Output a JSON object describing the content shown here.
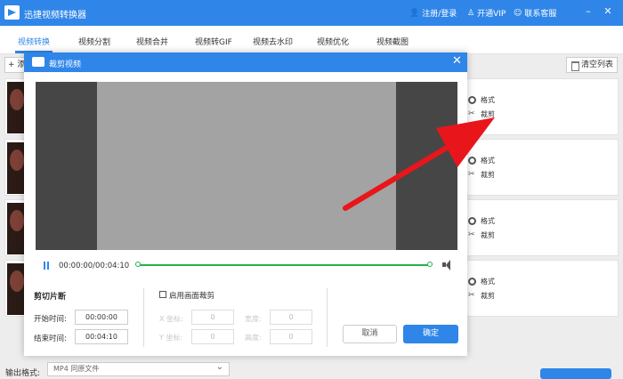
{
  "app": {
    "title": "迅捷视频转换器"
  },
  "header": {
    "login": "注册/登录",
    "vip": "开通VIP",
    "contact": "联系客服"
  },
  "tabs": [
    "视频转换",
    "视频分割",
    "视频合并",
    "视频转GIF",
    "视频去水印",
    "视频优化",
    "视频截图"
  ],
  "toolbar": {
    "add_label": "+ 添",
    "clear_label": "清空列表"
  },
  "file_list": {
    "actions": {
      "format": "格式",
      "crop": "裁剪"
    }
  },
  "dialog": {
    "title": "裁剪视频",
    "timecode": "00:00:00/00:04:10",
    "progress": 0,
    "cut_section": {
      "title": "剪切片断",
      "start_label": "开始时间:",
      "start_value": "00:00:00",
      "end_label": "结束时间:",
      "end_value": "00:04:10"
    },
    "crop": {
      "enable_label": "启用画面裁剪",
      "enabled": false,
      "x_label": "X 坐标:",
      "y_label": "Y 坐标:",
      "width_label": "宽度:",
      "height_label": "高度:",
      "x_value": "0",
      "y_value": "0",
      "width_value": "0",
      "height_value": "0"
    },
    "cancel_label": "取消",
    "ok_label": "确定"
  },
  "output": {
    "label": "输出格式:",
    "value": "MP4  同原文件"
  },
  "colors": {
    "primary": "#2f86e8",
    "track": "#22b14c",
    "arrow": "#e8161b"
  }
}
